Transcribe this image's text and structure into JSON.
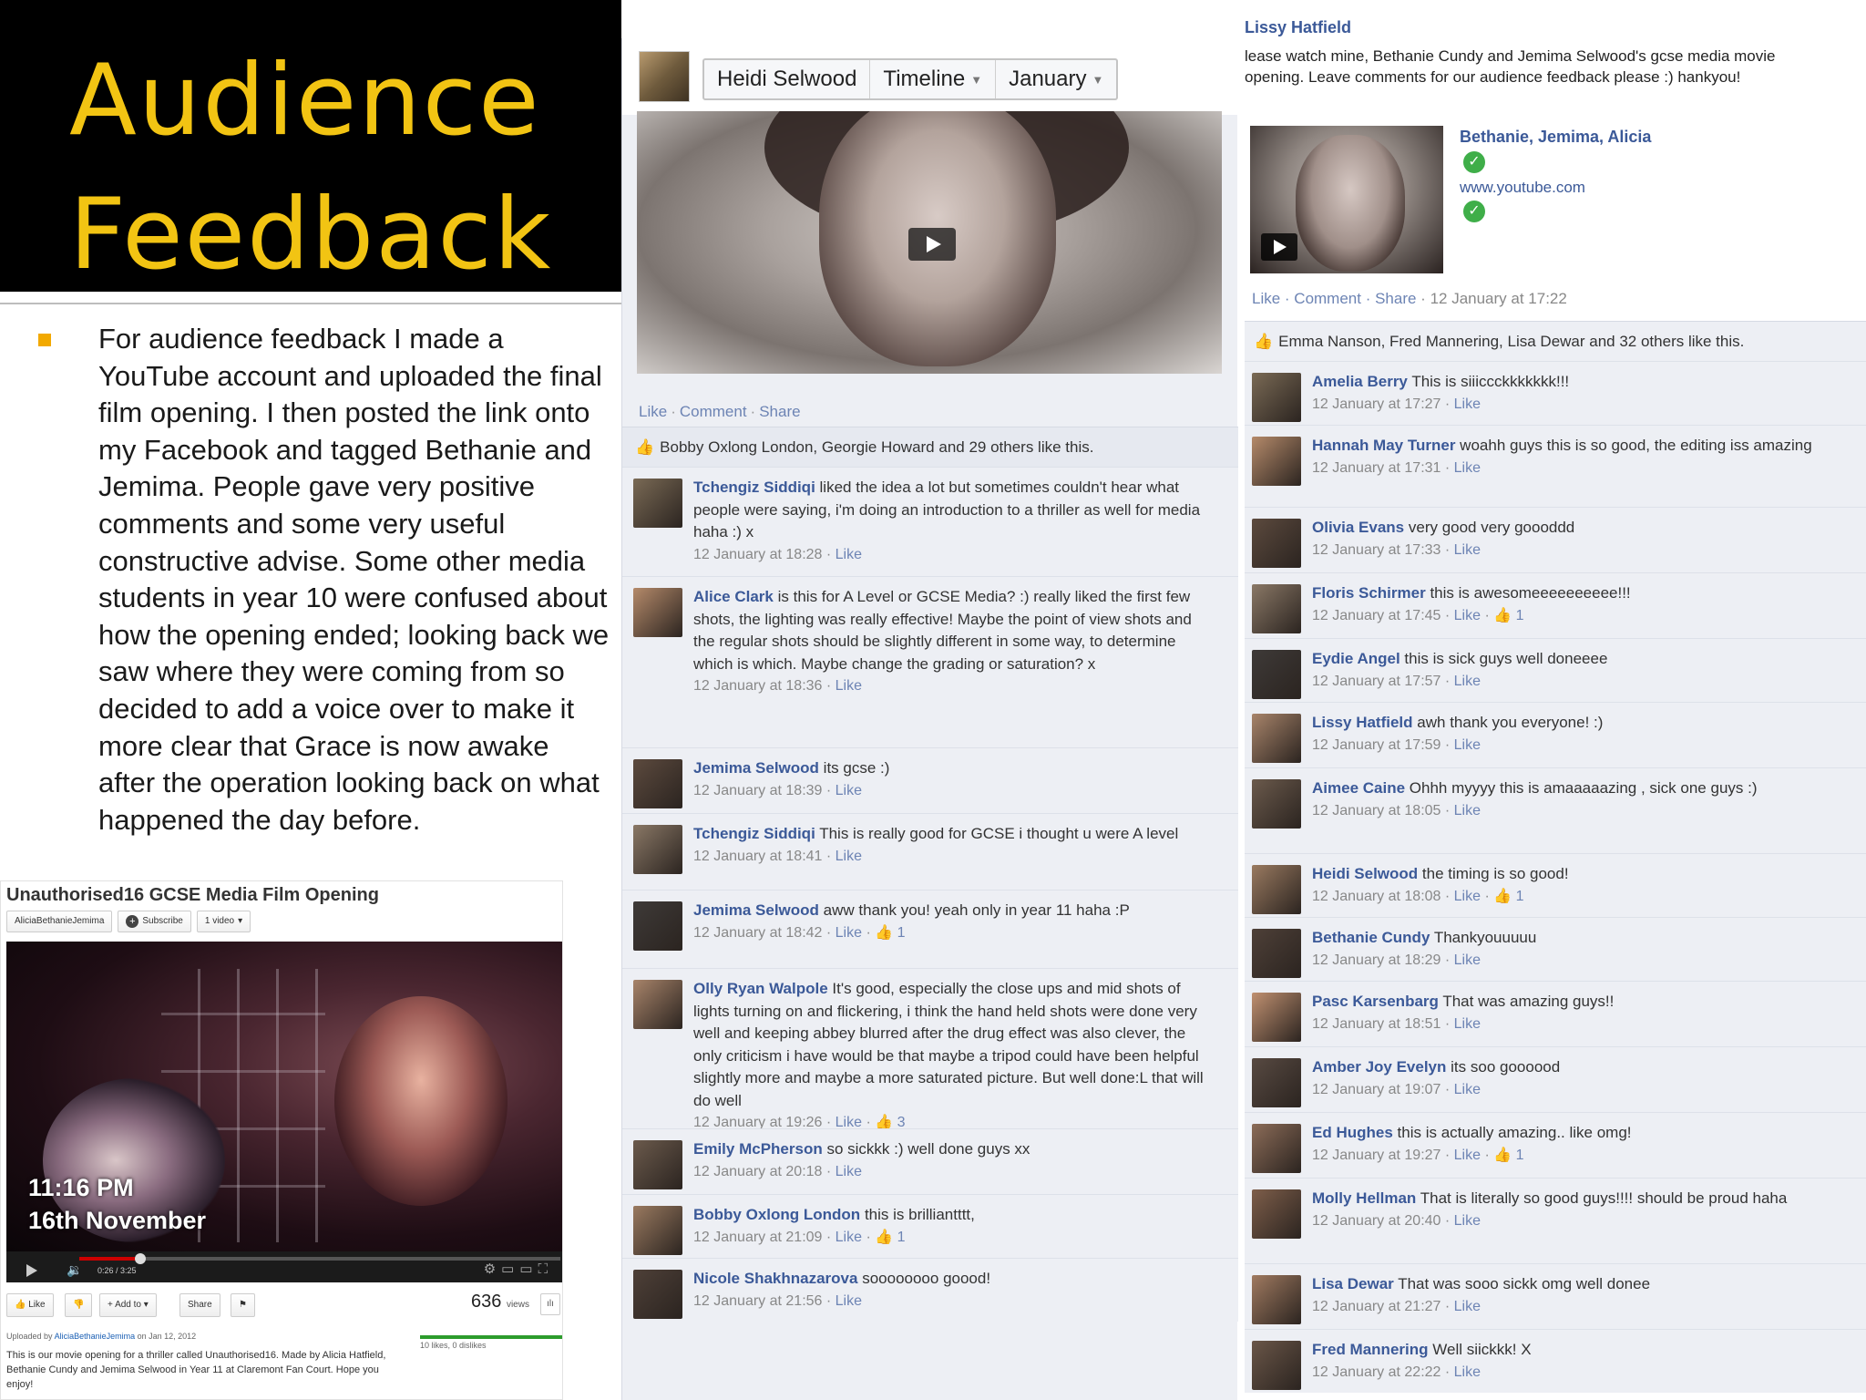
{
  "slide": {
    "title_line1": "Audience",
    "title_line2": "Feedback",
    "bullet": "For audience feedback  I made a YouTube account and uploaded the final film opening. I then posted the link  onto my Facebook  and tagged Bethanie and Jemima. People gave very positive  comments and some very useful constructive advise. Some other media students in year 10 were confused about how the opening ended; looking back we saw where they were coming from so decided to add a voice over to make it more clear that Grace is now awake after the operation looking back on what happened the day before."
  },
  "youtube": {
    "title": "Unauthorised16 GCSE Media Film Opening",
    "channel": "AliciaBethanieJemima",
    "subscribe": "Subscribe",
    "videos": "1 video",
    "overlay_time": "11:16 PM",
    "overlay_date": "16th November",
    "time_display": "0:26 / 3:25",
    "progress": 0.127,
    "like": "Like",
    "add_to": "+ Add to",
    "share": "Share",
    "views_count": "636",
    "views_label": "views",
    "likes_text": "10 likes, 0 dislikes",
    "uploaded_prefix": "Uploaded by",
    "uploaded_by": "AliciaBethanieJemima",
    "uploaded_date": "on Jan 12, 2012",
    "description": "This is our movie opening for a thriller called Unauthorised16. Made by Alicia Hatfield, Bethanie Cundy and Jemima Selwood in Year 11 at Claremont Fan Court. Hope you enjoy!"
  },
  "fb1": {
    "tabs": [
      "Heidi Selwood",
      "Timeline",
      "January"
    ],
    "actions": [
      "Like",
      "Comment",
      "Share"
    ],
    "likes_line": "Bobby Oxlong London, Georgie Howard and 29 others like this.",
    "comments": [
      {
        "name": "Tchengiz Siddiqi",
        "text": "liked the idea a lot but sometimes couldn't hear what people were saying, i'm doing an introduction to a thriller as well for media haha :) x",
        "meta": "12 January at 18:28",
        "like": "Like",
        "count": ""
      },
      {
        "name": "Alice Clark",
        "text": "is this for A Level or GCSE Media? :) really liked the first few shots, the lighting was really effective! Maybe the point of view shots and the regular shots should be slightly different in some way, to determine which is which. Maybe change the grading or saturation? x",
        "meta": "12 January at 18:36",
        "like": "Like",
        "count": ""
      },
      {
        "name": "Jemima Selwood",
        "text": "its gcse :)",
        "meta": "12 January at 18:39",
        "like": "Like",
        "count": ""
      },
      {
        "name": "Tchengiz Siddiqi",
        "text": "This is really good for GCSE i thought u were A level",
        "meta": "12 January at 18:41",
        "like": "Like",
        "count": ""
      },
      {
        "name": "Jemima Selwood",
        "text": "aww thank you! yeah only in year 11 haha :P",
        "meta": "12 January at 18:42",
        "like": "Like",
        "count": "1"
      },
      {
        "name": "Olly Ryan Walpole",
        "text": "It's good, especially the close ups and mid shots of lights turning on and flickering, i think the hand held shots were done very well and keeping abbey blurred after the drug effect was also clever, the only criticism i have would be that maybe a tripod could have been helpful slightly more and maybe a more saturated picture. But well done:L that will do well",
        "meta": "12 January at 19:26",
        "like": "Like",
        "count": "3"
      },
      {
        "name": "Emily McPherson",
        "text": "so sickkk :) well done guys xx",
        "meta": "12 January at 20:18",
        "like": "Like",
        "count": ""
      },
      {
        "name": "Bobby Oxlong London",
        "text": "this is brilliantttt,",
        "meta": "12 January at 21:09",
        "like": "Like",
        "count": "1"
      },
      {
        "name": "Nicole Shakhnazarova",
        "text": "soooooooo goood!",
        "meta": "12 January at 21:56",
        "like": "Like",
        "count": ""
      }
    ]
  },
  "fb2": {
    "poster": "Lissy Hatfield",
    "message": "lease watch mine, Bethanie Cundy and Jemima Selwood's gcse media movie opening. Leave comments for our audience feedback please :) hankyou!",
    "tagged": "Bethanie, Jemima, Alicia",
    "url": "www.youtube.com",
    "actions_line": "Like · Comment · Share",
    "timestamp": "12 January at 17:22",
    "likes_line": "Emma Nanson, Fred Mannering, Lisa Dewar and 32 others like this.",
    "comments": [
      {
        "name": "Amelia Berry",
        "text": "This is siiiccckkkkkkk!!!",
        "meta": "12 January at 17:27",
        "like": "Like",
        "count": ""
      },
      {
        "name": "Hannah May Turner",
        "text": "woahh guys this is so good, the editing iss amazing",
        "meta": "12 January at 17:31",
        "like": "Like",
        "count": ""
      },
      {
        "name": "Olivia Evans",
        "text": "very good very goooddd",
        "meta": "12 January at 17:33",
        "like": "Like",
        "count": ""
      },
      {
        "name": "Floris Schirmer",
        "text": "this is awesomeeeeeeeeee!!!",
        "meta": "12 January at 17:45",
        "like": "Like",
        "count": "1"
      },
      {
        "name": "Eydie Angel",
        "text": "this is sick guys well doneeee",
        "meta": "12 January at 17:57",
        "like": "Like",
        "count": ""
      },
      {
        "name": "Lissy Hatfield",
        "text": "awh thank you everyone! :)",
        "meta": "12 January at 17:59",
        "like": "Like",
        "count": ""
      },
      {
        "name": "Aimee Caine",
        "text": "Ohhh myyyy this is amaaaaazing , sick one guys :)",
        "meta": "12 January at 18:05",
        "like": "Like",
        "count": ""
      },
      {
        "name": "Heidi Selwood",
        "text": "the timing is so good!",
        "meta": "12 January at 18:08",
        "like": "Like",
        "count": "1"
      },
      {
        "name": "Bethanie Cundy",
        "text": "Thankyouuuuu",
        "meta": "12 January at 18:29",
        "like": "Like",
        "count": ""
      },
      {
        "name": "Pasc Karsenbarg",
        "text": "That was amazing guys!!",
        "meta": "12 January at 18:51",
        "like": "Like",
        "count": ""
      },
      {
        "name": "Amber Joy Evelyn",
        "text": "its soo goooood",
        "meta": "12 January at 19:07",
        "like": "Like",
        "count": ""
      },
      {
        "name": "Ed Hughes",
        "text": "this is actually amazing.. like omg!",
        "meta": "12 January at 19:27",
        "like": "Like",
        "count": "1"
      },
      {
        "name": "Molly Hellman",
        "text": "That is literally so good guys!!!! should be proud haha",
        "meta": "12 January at 20:40",
        "like": "Like",
        "count": ""
      },
      {
        "name": "Lisa Dewar",
        "text": "That was sooo sickk omg well donee",
        "meta": "12 January at 21:27",
        "like": "Like",
        "count": ""
      },
      {
        "name": "Fred Mannering",
        "text": "Well siickkk! X",
        "meta": "12 January at 22:22",
        "like": "Like",
        "count": ""
      }
    ]
  }
}
